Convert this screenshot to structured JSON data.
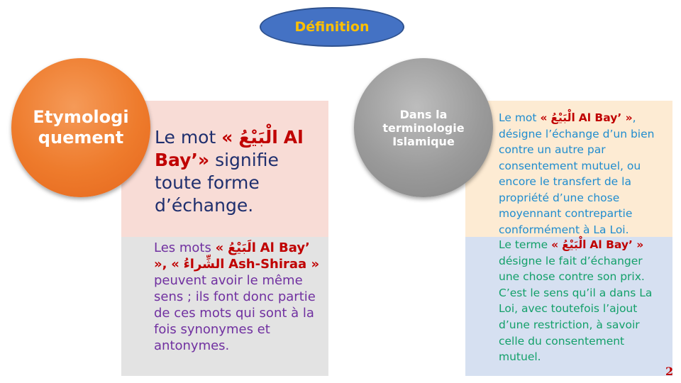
{
  "title": "Définition",
  "left": {
    "circle_label": "Etymologi quement",
    "top": {
      "prefix": "Le mot",
      "quote_open": "«",
      "arabic": "الْبَيْعُ",
      "term": "Al Bay’»",
      "rest": "signifie toute forme d’échange."
    },
    "bottom": {
      "prefix": "Les mots",
      "quote_open1": "«",
      "arabic1": "الَبَيْعُ",
      "term1": "Al Bay’ »",
      "comma": ",",
      "quote_open2": "«",
      "arabic2": "الشِّراءُ",
      "term2": "Ash-Shiraa »",
      "rest": "peuvent avoir le même sens ; ils font donc partie de ces mots qui sont à la fois synonymes et antonymes."
    }
  },
  "right": {
    "circle_label": "Dans la terminologie Islamique",
    "top": {
      "prefix": "Le mot",
      "quote_open": "«",
      "arabic": "الْبَيْعُ",
      "term": "Al Bay’ »",
      "rest": ", désigne l’échange d’un bien contre un autre par consentement mutuel, ou encore le transfert de la propriété d’une chose moyennant contrepartie conformément à La Loi."
    },
    "bottom": {
      "prefix": "Le terme",
      "quote_open": "«",
      "arabic": "الْبَيْعُ",
      "term": "Al Bay’ »",
      "rest": "désigne le fait d’échanger une chose contre son prix. C’est le sens qu’il a dans La Loi, avec toutefois l’ajout d’une restriction, à savoir celle du consentement mutuel."
    }
  },
  "page_number": "2",
  "colors": {
    "title_bg": "#4472c4",
    "title_text": "#ffc000",
    "left_circle": "#ee7b2c",
    "right_circle": "#9a9a9a",
    "left_top_bg": "#f8dcd6",
    "left_bottom_bg": "#e3e3e3",
    "right_top_bg": "#fdebd3",
    "right_bottom_bg": "#d6e0f1",
    "term_red": "#c00000"
  }
}
